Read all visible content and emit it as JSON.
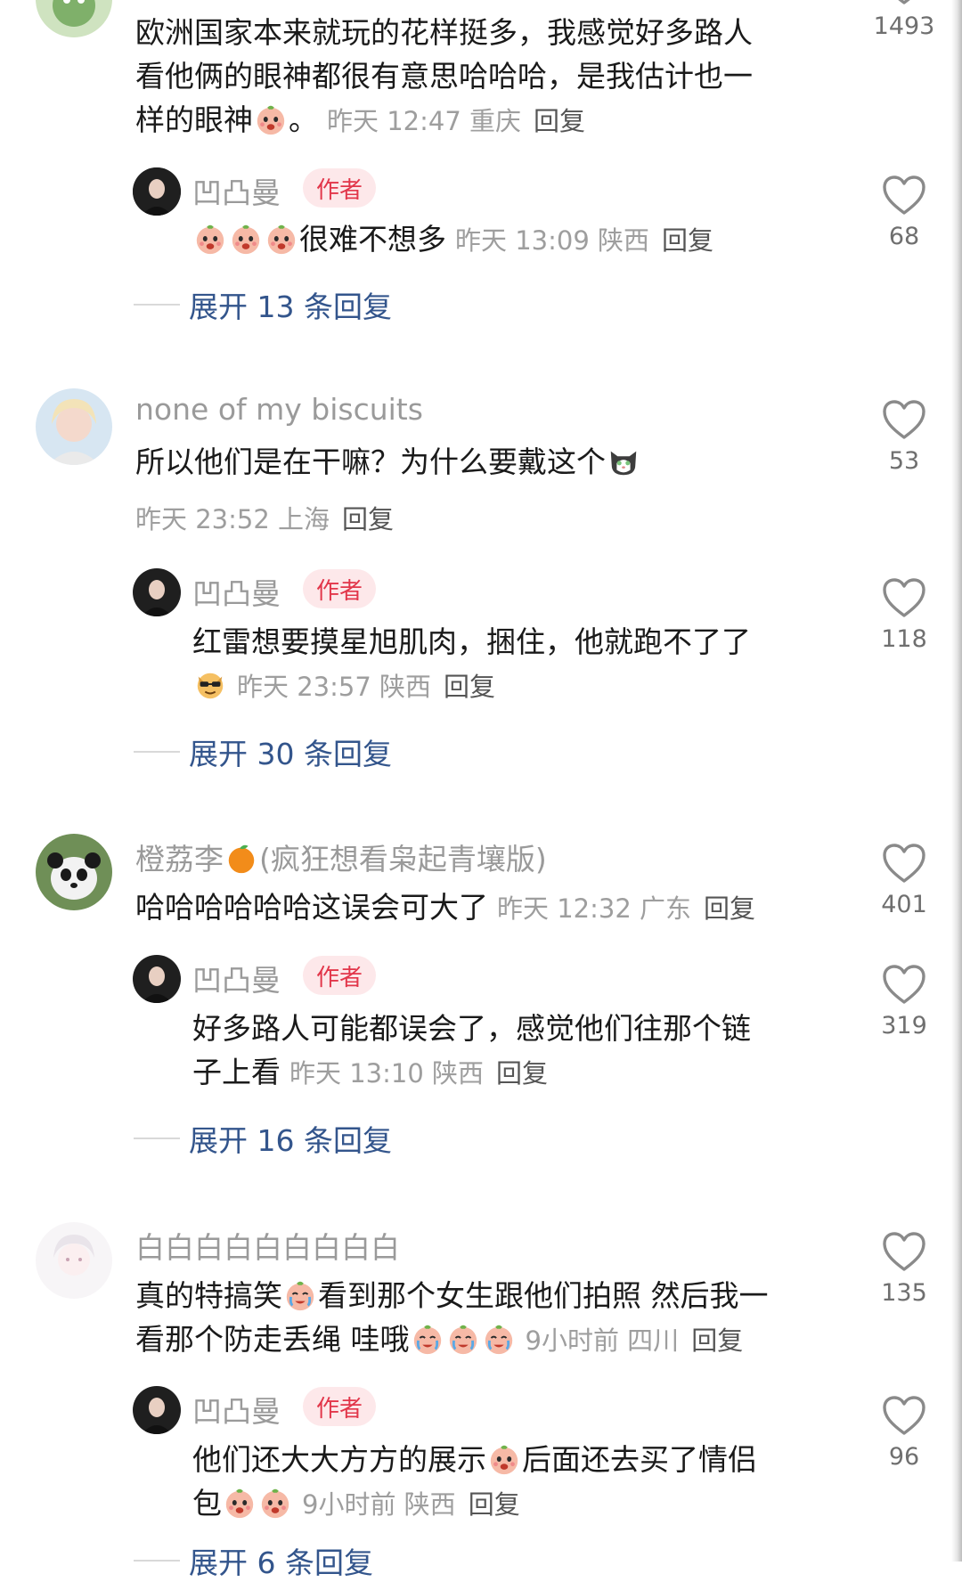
{
  "comments": [
    {
      "text_lines": [
        "欧洲国家本来就玩的花样挺多，我感觉好多路人",
        "看他俩的眼神都很有意思哈哈哈，是我估计也一",
        "样的眼神"
      ],
      "text_suffix": "。",
      "time": "昨天 12:47",
      "location": "重庆",
      "reply_label": "回复",
      "likes": "1493",
      "reply": {
        "name": "凹凸曼",
        "badge": "作者",
        "text": "很难不想多",
        "time": "昨天 13:09",
        "location": "陕西",
        "reply_label": "回复",
        "likes": "68"
      },
      "expand": "展开 13 条回复"
    },
    {
      "name": "none of my biscuits",
      "text": "所以他们是在干嘛？为什么要戴这个",
      "time": "昨天 23:52",
      "location": "上海",
      "reply_label": "回复",
      "likes": "53",
      "reply": {
        "name": "凹凸曼",
        "badge": "作者",
        "text": "红雷想要摸星旭肌肉，捆住，他就跑不了了",
        "time": "昨天 23:57",
        "location": "陕西",
        "reply_label": "回复",
        "likes": "118"
      },
      "expand": "展开 30 条回复"
    },
    {
      "name_prefix": "橙荔李",
      "name_suffix": "(疯狂想看枭起青壤版)",
      "text": "哈哈哈哈哈哈这误会可大了",
      "time": "昨天 12:32",
      "location": "广东",
      "reply_label": "回复",
      "likes": "401",
      "reply": {
        "name": "凹凸曼",
        "badge": "作者",
        "text_lines": [
          "好多路人可能都误会了，感觉他们往那个链",
          "子上看"
        ],
        "time": "昨天 13:10",
        "location": "陕西",
        "reply_label": "回复",
        "likes": "319"
      },
      "expand": "展开 16 条回复"
    },
    {
      "name": "白白白白白白白白白",
      "text_part1": "真的特搞笑",
      "text_part2": "看到那个女生跟他们拍照 然后我一",
      "text_line2": "看那个防走丢绳 哇哦",
      "time": "9小时前",
      "location": "四川",
      "reply_label": "回复",
      "likes": "135",
      "reply": {
        "name": "凹凸曼",
        "badge": "作者",
        "text_part1": "他们还大大方方的展示",
        "text_part2": "后面还去买了情侣",
        "text_line2": "包",
        "time": "9小时前",
        "location": "陕西",
        "reply_label": "回复",
        "likes": "96"
      },
      "expand": "展开 6 条回复"
    }
  ],
  "colors": {
    "author_badge_bg": "#fde8ea",
    "author_badge_text": "#e2364a",
    "expand_link": "#33558c",
    "meta_gray": "#9e9e9e"
  },
  "icons": [
    "heart-outline-icon",
    "peach-emoji",
    "cat-emoji",
    "dog-sunglasses-emoji",
    "orange-emoji",
    "crying-emoji"
  ]
}
